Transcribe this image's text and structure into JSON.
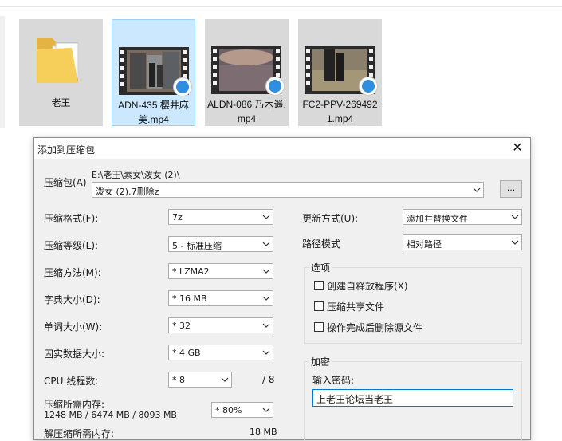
{
  "explorer": {
    "files": [
      {
        "name": "老王",
        "type": "folder"
      },
      {
        "name": "ADN-435 樱井麻美.mp4",
        "type": "video"
      },
      {
        "name": "ALDN-086 乃木遥.mp4",
        "type": "video"
      },
      {
        "name": "FC2-PPV-2694921.mp4",
        "type": "video"
      }
    ]
  },
  "dialog": {
    "title": "添加到压缩包",
    "archive_label": "压缩包(A)",
    "archive_path": "E:\\老王\\素女\\泼女 (2)\\",
    "archive_name": "泼女 (2).7删除z",
    "browse_label": "...",
    "format": {
      "label": "压缩格式(F):",
      "value": "7z"
    },
    "level": {
      "label": "压缩等级(L):",
      "value": "5 - 标准压缩"
    },
    "method": {
      "label": "压缩方法(M):",
      "value": "* LZMA2"
    },
    "dict": {
      "label": "字典大小(D):",
      "value": "* 16 MB"
    },
    "word": {
      "label": "单词大小(W):",
      "value": "* 32"
    },
    "solid": {
      "label": "固实数据大小:",
      "value": "* 4 GB"
    },
    "threads": {
      "label": "CPU 线程数:",
      "value": "* 8",
      "max": "/ 8"
    },
    "memory": {
      "label": "压缩所需内存:",
      "detail": "1248 MB / 6474 MB / 8093 MB",
      "value": "* 80%"
    },
    "decomp": {
      "label": "解压缩所需内存:",
      "value": "18 MB"
    },
    "update": {
      "label": "更新方式(U):",
      "value": "添加并替换文件"
    },
    "pathmode": {
      "label": "路径模式",
      "value": "相对路径"
    },
    "options": {
      "title": "选项",
      "items": [
        "创建自释放程序(X)",
        "压缩共享文件",
        "操作完成后删除源文件"
      ]
    },
    "encryption": {
      "title": "加密",
      "password_label": "输入密码:",
      "password_value": "上老王论坛当老王"
    }
  },
  "colors": {
    "selection": "#cce8ff",
    "selection_border": "#99d1ff",
    "focus_border": "#0078d7",
    "dialog_bg": "#f0f0f0"
  }
}
